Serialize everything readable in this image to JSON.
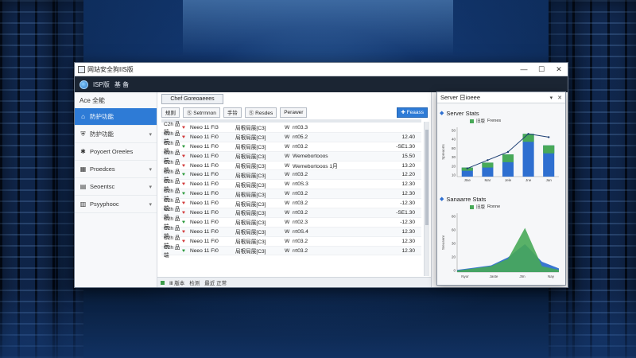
{
  "colors": {
    "accent": "#2e7bd6",
    "bar_blue": "#2e6fd0",
    "bar_green": "#48a958",
    "line": "#1d3f73"
  },
  "window": {
    "title": "网站安全狗IIS版",
    "appbar_title": "ISP版",
    "appbar_extra": "基 备",
    "controls": [
      "—",
      "☐",
      "✕"
    ]
  },
  "sidebar": {
    "header": "Ace 全能",
    "items": [
      {
        "label": "防护功能",
        "icon": "home-icon",
        "glyph": "⌂",
        "active": true
      },
      {
        "label": "防护功能",
        "icon": "shield-icon",
        "glyph": "⛨",
        "active": false,
        "chevron": "▾"
      },
      {
        "label": "Poyoert Oreeles",
        "icon": "gear-icon",
        "glyph": "✱",
        "active": false
      },
      {
        "label": "Proedces",
        "icon": "grid-icon",
        "glyph": "▦",
        "active": false,
        "chevron": "▾"
      },
      {
        "label": "Seoentsc",
        "icon": "server-icon",
        "glyph": "▤",
        "active": false,
        "chevron": "▾"
      },
      {
        "label": "Psyyphooc",
        "icon": "report-icon",
        "glyph": "▥",
        "active": false,
        "chevron": "▾"
      }
    ]
  },
  "center": {
    "panel_title": "Chef Goreoaeees",
    "toolbar": [
      "规则",
      "Ⓢ Setrrnnon",
      "手铃",
      "Ⓢ Resdes",
      "Perawer"
    ],
    "primary_button": "✚ Feaass",
    "rows": [
      {
        "id": "C2h 品端",
        "flag": "♥",
        "flag_color": "red",
        "time": "Neeo 11 FI3",
        "proc": "局根局展[C3]",
        "v": "W",
        "val": "rrt03.3",
        "num": ""
      },
      {
        "id": "C2h 品端",
        "flag": "♥",
        "flag_color": "red",
        "time": "Neeo 11 FI0",
        "proc": "局根局展[C3]",
        "v": "W",
        "val": "rrt05.2",
        "num": "12.40"
      },
      {
        "id": "C2h 品端",
        "flag": "♥",
        "flag_color": "green",
        "time": "Neeo 11 FI0",
        "proc": "局根局展[C3]",
        "v": "W",
        "val": "rrt03.2",
        "num": "-SE1.30"
      },
      {
        "id": "C2h 品端",
        "flag": "♥",
        "flag_color": "red",
        "time": "Neeo 11 FI0",
        "proc": "局根局展[C3]",
        "v": "W",
        "val": "Wemebortooos",
        "num": "15.50"
      },
      {
        "id": "C2h 品端",
        "flag": "♥",
        "flag_color": "red",
        "time": "Neeo 11 FI0",
        "proc": "局根局展[C3]",
        "v": "W",
        "val": "Wemebortooos 1月",
        "num": "13.20"
      },
      {
        "id": "C2h 品端",
        "flag": "♥",
        "flag_color": "green",
        "time": "Neeo 11 FI0",
        "proc": "局根局展[C3]",
        "v": "W",
        "val": "rrt03.2",
        "num": "12.20"
      },
      {
        "id": "C2h 品端",
        "flag": "♥",
        "flag_color": "red",
        "time": "Neeo 11 FI0",
        "proc": "局根局展[C3]",
        "v": "W",
        "val": "rrt0S.3",
        "num": "12.30"
      },
      {
        "id": "C2h 品端",
        "flag": "♥",
        "flag_color": "green",
        "time": "Neeo 11 FI0",
        "proc": "局根局展[C3]",
        "v": "W",
        "val": "rrt03.2",
        "num": "12.30"
      },
      {
        "id": "C2h 品端",
        "flag": "♥",
        "flag_color": "red",
        "time": "Neeo 11 FI0",
        "proc": "局根局展[C3]",
        "v": "W",
        "val": "rrt03.2",
        "num": "-12.30"
      },
      {
        "id": "C2h 品端",
        "flag": "♥",
        "flag_color": "red",
        "time": "Neeo 11 FI0",
        "proc": "局根局展[C3]",
        "v": "W",
        "val": "rrt03.2",
        "num": "-SE1.30"
      },
      {
        "id": "C2h 品端",
        "flag": "♥",
        "flag_color": "green",
        "time": "Neeo 11 FI0",
        "proc": "局根局展[C3]",
        "v": "W",
        "val": "rrt02.3",
        "num": "-12.30"
      },
      {
        "id": "C2h 品端",
        "flag": "♥",
        "flag_color": "red",
        "time": "Neeo 11 FI0",
        "proc": "局根局展[C3]",
        "v": "W",
        "val": "rrt0S.4",
        "num": "12.30"
      },
      {
        "id": "C2h 品端",
        "flag": "♥",
        "flag_color": "red",
        "time": "Neeo 11 FI0",
        "proc": "局根局展[C3]",
        "v": "W",
        "val": "rrt03.2",
        "num": "12.30"
      },
      {
        "id": "C2h 品端",
        "flag": "♥",
        "flag_color": "green",
        "time": "Neeo 11 FI0",
        "proc": "局根局展[C3]",
        "v": "W",
        "val": "rrt03.2",
        "num": "12.30"
      }
    ],
    "status": [
      "Ⅲ 版本",
      "检测",
      "最近 正常"
    ]
  },
  "stats": {
    "title": "Server 日ioeee",
    "controls": [
      "▾",
      "✕"
    ],
    "chart1_title": "Server Stats",
    "chart2_title": "Sanaarre Stats",
    "legend1": [
      "旧版",
      "Frenes"
    ],
    "legend2": [
      "旧版",
      "Ronne"
    ]
  },
  "chart_data": [
    {
      "type": "bar",
      "title": "Server Stats",
      "categories": [
        "Jtse",
        "Mar",
        "Jele",
        "Jne",
        "Jan"
      ],
      "series": [
        {
          "name": "旧版",
          "values": [
            6,
            14,
            22,
            10,
            11
          ]
        },
        {
          "name": "Frenes",
          "values": [
            11,
            17,
            27,
            52,
            38
          ]
        }
      ],
      "line_overlay": [
        10,
        20,
        30,
        52,
        48
      ],
      "yticks": [
        "50",
        "40",
        "80",
        "30",
        "20",
        "10"
      ],
      "ylabel": "Spreaorts",
      "ylim": [
        0,
        60
      ]
    },
    {
      "type": "area",
      "title": "Sanaarre Stats",
      "categories": [
        "Nyor",
        "Jaste",
        "Jtm",
        "Nay"
      ],
      "series": [
        {
          "name": "旧版",
          "values": [
            3,
            6,
            9,
            20,
            38,
            14,
            5
          ]
        },
        {
          "name": "Ronne",
          "values": [
            2,
            5,
            8,
            18,
            60,
            8,
            3
          ]
        }
      ],
      "yticks": [
        "80",
        "60",
        "30",
        "20",
        "0"
      ],
      "ylabel": "Sreusenr",
      "ylim": [
        0,
        80
      ]
    }
  ]
}
